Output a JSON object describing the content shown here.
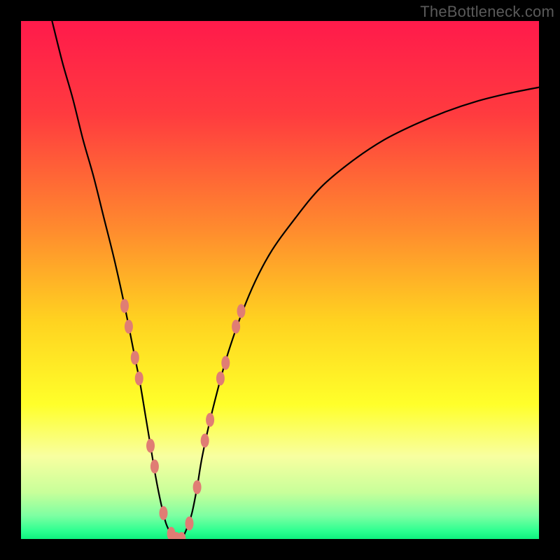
{
  "watermark": "TheBottleneck.com",
  "chart_data": {
    "type": "line",
    "title": "",
    "xlabel": "",
    "ylabel": "",
    "xlim": [
      0,
      100
    ],
    "ylim": [
      0,
      100
    ],
    "background_gradient_stops": [
      {
        "offset": 0.0,
        "color": "#ff1a4b"
      },
      {
        "offset": 0.18,
        "color": "#ff3b3f"
      },
      {
        "offset": 0.4,
        "color": "#ff8a2e"
      },
      {
        "offset": 0.58,
        "color": "#ffd320"
      },
      {
        "offset": 0.74,
        "color": "#ffff2a"
      },
      {
        "offset": 0.84,
        "color": "#f8ffa0"
      },
      {
        "offset": 0.91,
        "color": "#c8ff9a"
      },
      {
        "offset": 0.955,
        "color": "#7dffa2"
      },
      {
        "offset": 0.985,
        "color": "#2bff90"
      },
      {
        "offset": 1.0,
        "color": "#0ef17e"
      }
    ],
    "series": [
      {
        "name": "curve",
        "color": "#000000",
        "stroke_width": 2.2,
        "x": [
          6,
          8,
          10,
          12,
          14,
          16,
          18,
          20,
          22,
          23,
          24,
          25,
          26,
          27,
          28,
          29,
          30,
          31,
          32,
          33,
          34,
          35,
          37,
          40,
          44,
          48,
          53,
          58,
          64,
          70,
          76,
          82,
          88,
          94,
          100
        ],
        "y": [
          100,
          92,
          85,
          77,
          70,
          62,
          54,
          45,
          35,
          30,
          24,
          18,
          12,
          7,
          3,
          1,
          0,
          0,
          2,
          5,
          10,
          16,
          25,
          36,
          47,
          55,
          62,
          68,
          73,
          77,
          80,
          82.5,
          84.5,
          86,
          87.2
        ]
      }
    ],
    "markers": {
      "color": "#e07d74",
      "rx": 6,
      "ry": 10,
      "points": [
        {
          "x": 20.0,
          "y": 45
        },
        {
          "x": 20.8,
          "y": 41
        },
        {
          "x": 22.0,
          "y": 35
        },
        {
          "x": 22.8,
          "y": 31
        },
        {
          "x": 25.0,
          "y": 18
        },
        {
          "x": 25.8,
          "y": 14
        },
        {
          "x": 27.5,
          "y": 5
        },
        {
          "x": 29.0,
          "y": 1
        },
        {
          "x": 30.0,
          "y": 0
        },
        {
          "x": 31.0,
          "y": 0
        },
        {
          "x": 32.5,
          "y": 3
        },
        {
          "x": 34.0,
          "y": 10
        },
        {
          "x": 35.5,
          "y": 19
        },
        {
          "x": 36.5,
          "y": 23
        },
        {
          "x": 38.5,
          "y": 31
        },
        {
          "x": 39.5,
          "y": 34
        },
        {
          "x": 41.5,
          "y": 41
        },
        {
          "x": 42.5,
          "y": 44
        }
      ]
    }
  }
}
